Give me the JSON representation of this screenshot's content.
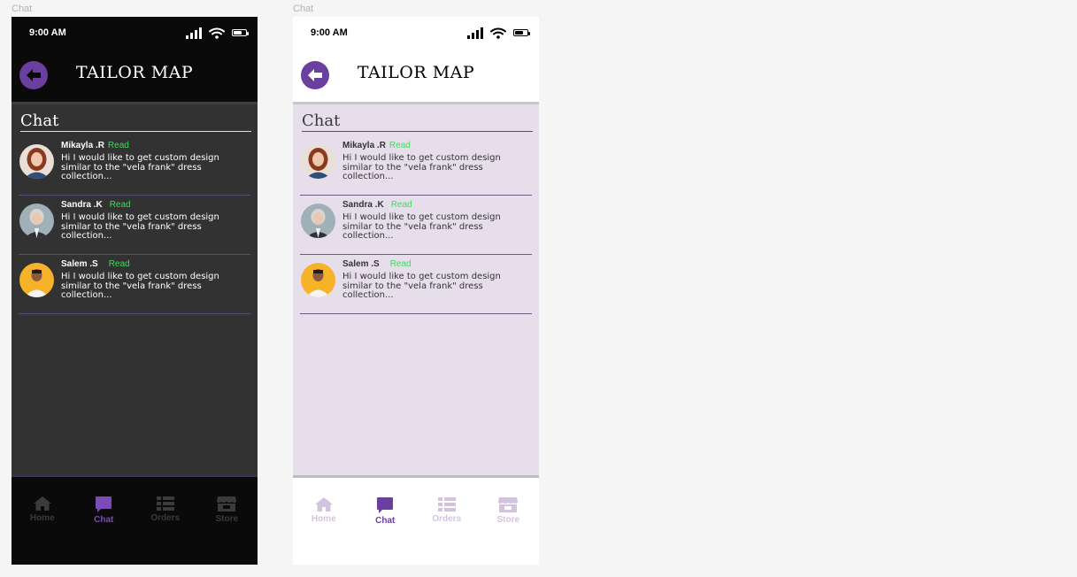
{
  "frames": [
    {
      "label": "Chat",
      "theme": "dark",
      "status_bar": {
        "time": "9:00 AM"
      },
      "header": {
        "title": "TAILOR MAP"
      },
      "section_title": "Chat",
      "chats": [
        {
          "name": "Mikayla .R",
          "status": "Read",
          "message": "Hi I would like to get custom design similar to the \"vela frank\" dress collection..."
        },
        {
          "name": "Sandra .K",
          "status": "Read",
          "message": "Hi I would like to get custom design similar to the \"vela frank\" dress collection..."
        },
        {
          "name": "Salem .S",
          "status": "Read",
          "message": "Hi I would like to get custom design similar to the \"vela frank\" dress collection..."
        }
      ],
      "nav": [
        {
          "label": "Home",
          "icon": "home-icon"
        },
        {
          "label": "Chat",
          "icon": "chat-icon",
          "active": true
        },
        {
          "label": "Orders",
          "icon": "orders-icon"
        },
        {
          "label": "Store",
          "icon": "store-icon"
        }
      ]
    },
    {
      "label": "Chat",
      "theme": "light",
      "status_bar": {
        "time": "9:00 AM"
      },
      "header": {
        "title": "TAILOR MAP"
      },
      "section_title": "Chat",
      "chats": [
        {
          "name": "Mikayla .R",
          "status": "Read",
          "message": "Hi I would like to get custom design similar to the \"vela frank\" dress collection..."
        },
        {
          "name": "Sandra .K",
          "status": "Read",
          "message": "Hi I would like to get custom design similar to the \"vela frank\" dress collection..."
        },
        {
          "name": "Salem .S",
          "status": "Read",
          "message": "Hi I would like to get custom design similar to the \"vela frank\" dress collection..."
        }
      ],
      "nav": [
        {
          "label": "Home",
          "icon": "home-icon"
        },
        {
          "label": "Chat",
          "icon": "chat-icon",
          "active": true
        },
        {
          "label": "Orders",
          "icon": "orders-icon"
        },
        {
          "label": "Store",
          "icon": "store-icon"
        }
      ]
    }
  ],
  "colors": {
    "accent": "#6b3fa0",
    "read_status": "#3ddc5a",
    "dark_content_bg": "#323232",
    "light_content_bg": "#e6dfeb"
  }
}
